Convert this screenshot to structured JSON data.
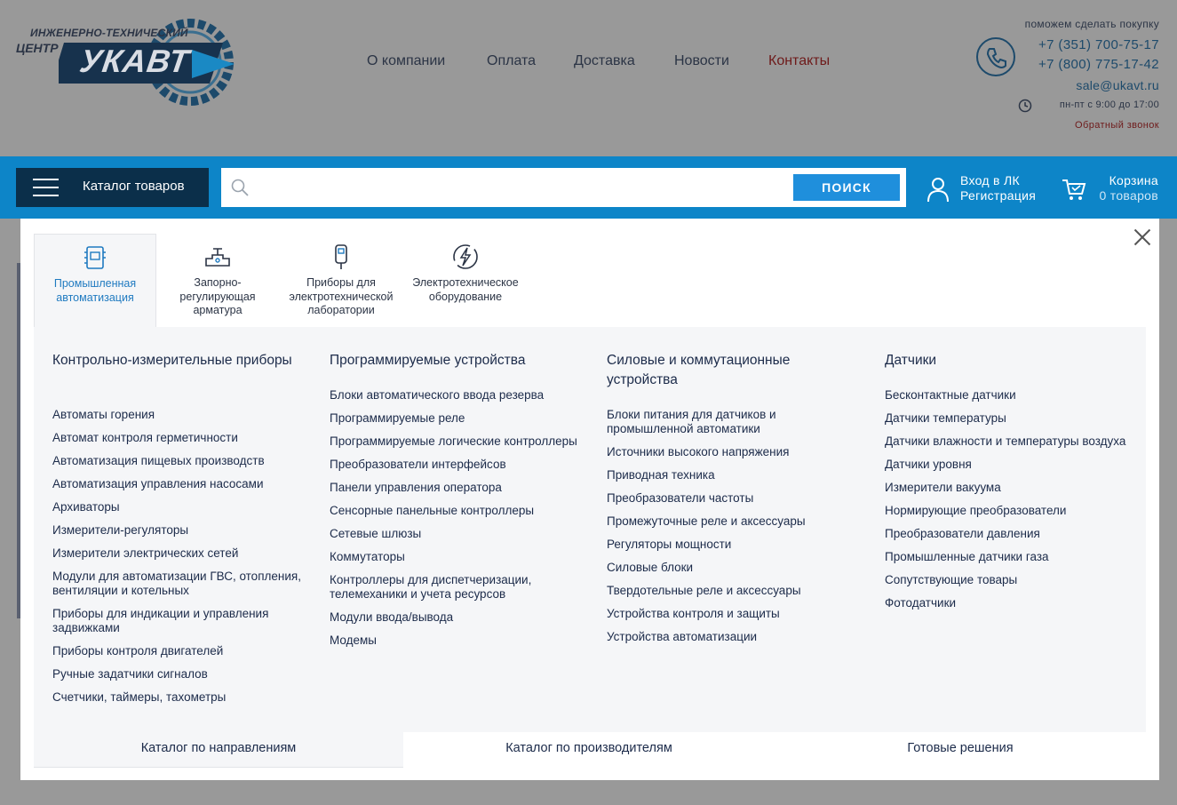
{
  "logo": {
    "tagline_line1": "ИНЖЕНЕРНО-ТЕХНИЧЕСКИЙ",
    "tagline_line2": "ЦЕНТР",
    "brand": "УКАВТ"
  },
  "nav": {
    "items": [
      {
        "label": "О компании"
      },
      {
        "label": "Оплата"
      },
      {
        "label": "Доставка"
      },
      {
        "label": "Новости"
      },
      {
        "label": "Контакты",
        "active": true
      }
    ]
  },
  "contacts": {
    "help_text": "поможем сделать покупку",
    "phone1": "+7 (351) 700-75-17",
    "phone2": "+7 (800) 775-17-42",
    "email": "sale@ukavt.ru",
    "hours": "пн-пт с 9:00 до 17:00",
    "callback": "Обратный звонок"
  },
  "toolbar": {
    "catalog_label": "Каталог товаров",
    "search_placeholder": "",
    "search_button": "ПОИСК",
    "login_label": "Вход в ЛК",
    "register_label": "Регистрация",
    "cart_label": "Корзина",
    "cart_count": "0 товаров"
  },
  "menu": {
    "category_tabs": [
      {
        "label": "Промышленная автоматизация",
        "icon": "controller-icon",
        "active": true
      },
      {
        "label": "Запорно-регулирующая арматура",
        "icon": "valve-icon"
      },
      {
        "label": "Приборы для электротехнической лаборатории",
        "icon": "tester-icon"
      },
      {
        "label": "Электротехническое оборудование",
        "icon": "lightning-icon"
      }
    ],
    "columns": [
      {
        "title": "Контрольно-измерительные приборы",
        "items": [
          "Автоматы горения",
          "Автомат контроля герметичности",
          "Автоматизация пищевых производств",
          "Автоматизация управления насосами",
          "Архиваторы",
          "Измерители-регуляторы",
          "Измерители электрических сетей",
          "Модули для автоматизации ГВС, отопления, вентиляции и котельных",
          "Приборы для индикации и управления задвижками",
          "Приборы контроля двигателей",
          "Ручные задатчики сигналов",
          "Счетчики, таймеры, тахометры"
        ]
      },
      {
        "title": "Программируемые устройства",
        "items": [
          "Блоки автоматического ввода резерва",
          "Программируемые реле",
          "Программируемые логические контроллеры",
          "Преобразователи интерфейсов",
          "Панели управления оператора",
          "Сенсорные панельные контроллеры",
          "Сетевые шлюзы",
          "Коммутаторы",
          "Контроллеры для диспетчеризации, телемеханики и учета ресурсов",
          "Модули ввода/вывода",
          "Модемы"
        ]
      },
      {
        "title": "Силовые и коммутационные устройства",
        "items": [
          "Блоки питания для датчиков и промышленной автоматики",
          "Источники высокого напряжения",
          "Приводная техника",
          "Преобразователи частоты",
          "Промежуточные реле и аксессуары",
          "Регуляторы мощности",
          "Силовые блоки",
          "Твердотельные реле и аксессуары",
          "Устройства контроля и защиты",
          "Устройства автоматизации"
        ]
      },
      {
        "title": "Датчики",
        "items": [
          "Бесконтактные датчики",
          "Датчики температуры",
          "Датчики влажности и температуры воздуха",
          "Датчики уровня",
          "Измерители вакуума",
          "Нормирующие преобразователи",
          "Преобразователи давления",
          "Промышленные датчики газа",
          "Сопутствующие товары",
          "Фотодатчики"
        ]
      }
    ],
    "bottom_tabs": [
      {
        "label": "Каталог по направлениям",
        "active": true
      },
      {
        "label": "Каталог по производителям"
      },
      {
        "label": "Готовые решения"
      }
    ]
  },
  "colors": {
    "accent_blue": "#0d85c8",
    "dark_navy": "#0b2f4a",
    "search_button": "#1f8fdc",
    "active_link": "#6e1a1a"
  }
}
